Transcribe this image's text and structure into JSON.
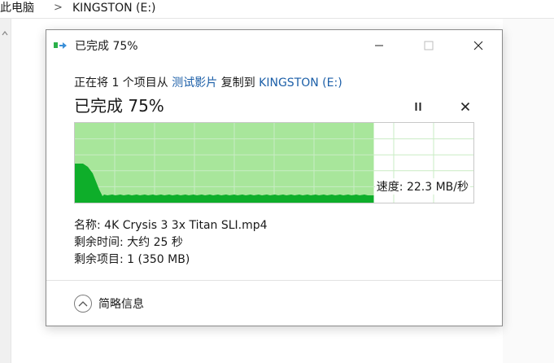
{
  "explorer": {
    "breadcrumb": [
      "此电脑",
      "KINGSTON (E:)"
    ],
    "separator": ">"
  },
  "dialog": {
    "title": "已完成 75%",
    "copy_text": {
      "prefix": "正在将 1 个项目从 ",
      "source": "测试影片",
      "middle": " 复制到 ",
      "destination": "KINGSTON (E:)"
    },
    "progress_heading": "已完成 75%",
    "progress_fraction": 0.75,
    "speed_text": "速度: 22.3 MB/秒",
    "name_line": "名称: 4K Crysis 3 3x Titan SLI.mp4",
    "time_remaining_line": "剩余时间: 大约 25 秒",
    "items_remaining_line": "剩余项目: 1 (350 MB)",
    "details_label": "简略信息"
  },
  "colors": {
    "progress_fill": "#a8e69b",
    "throughput": "#0eae2a",
    "grid": "#c9ecc4",
    "link": "#1c5fa8"
  },
  "icons": {
    "title": "copy-progress-icon",
    "minimize": "minimize-icon",
    "maximize": "maximize-icon",
    "close": "close-icon",
    "pause": "pause-icon",
    "cancel": "cancel-icon",
    "details": "chevron-up-icon"
  }
}
